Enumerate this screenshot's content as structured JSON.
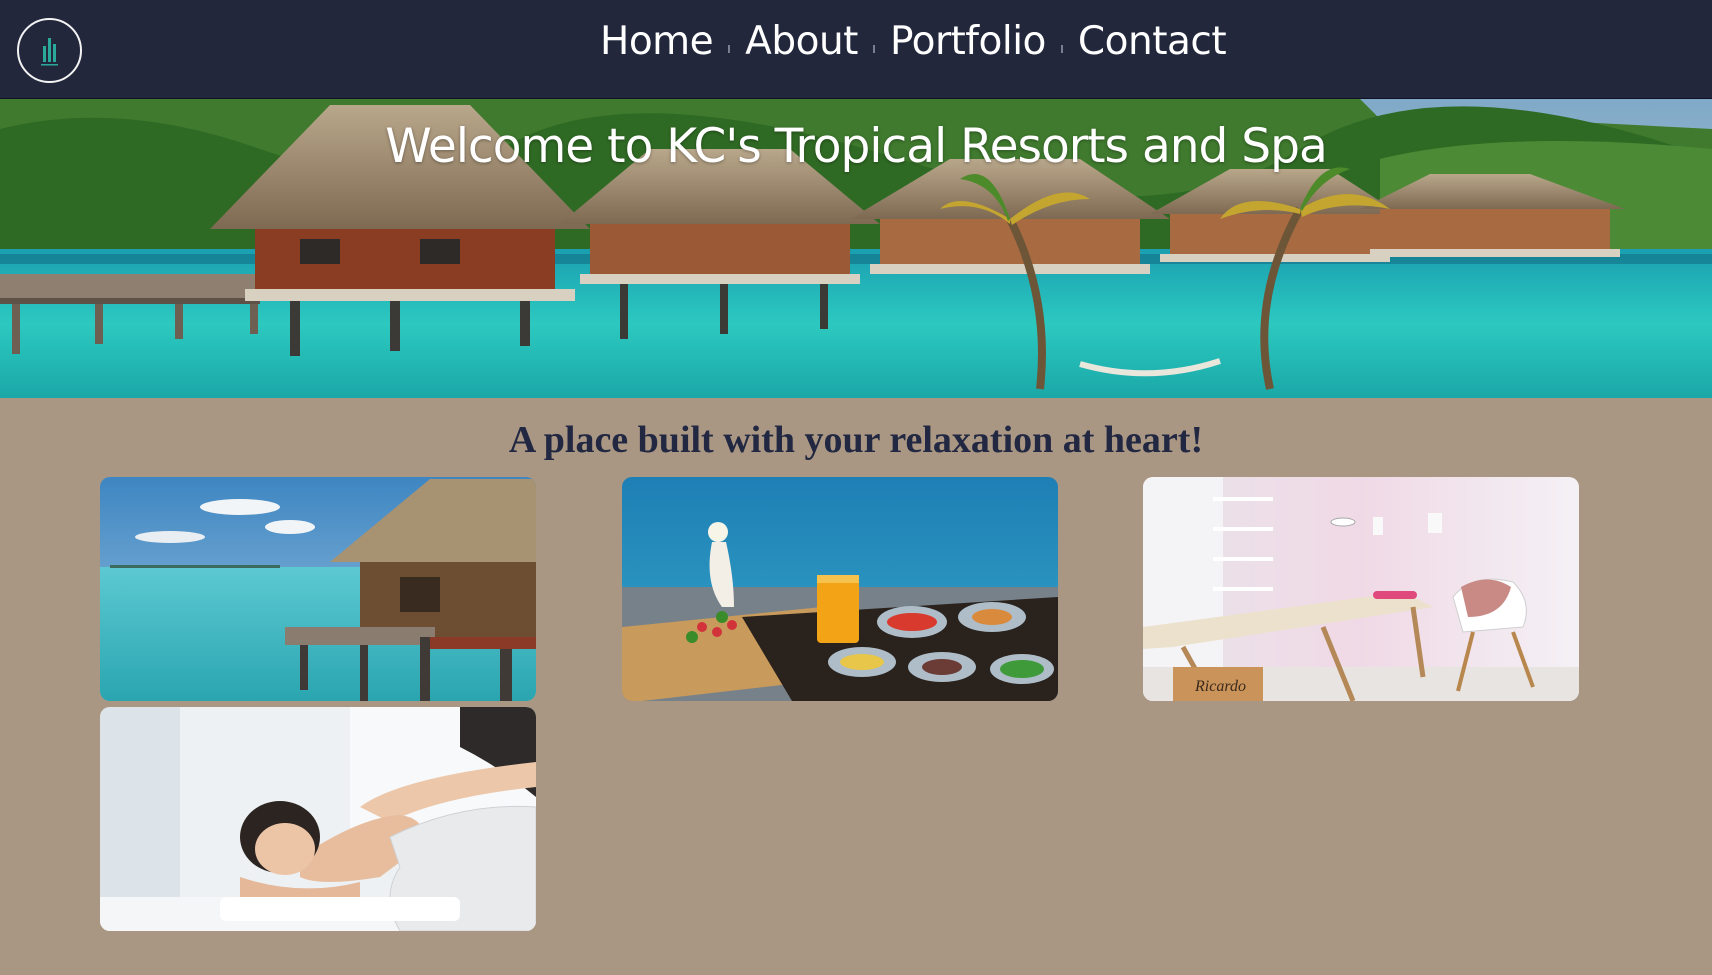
{
  "header": {
    "logo_icon": "resort-tower-logo-icon",
    "nav": [
      "Home",
      "About",
      "Portfolio",
      "Contact"
    ]
  },
  "hero": {
    "title": "Welcome to KC's Tropical Resorts and Spa",
    "image": "overwater-bungalows-photo"
  },
  "main": {
    "tagline": "A place built with your relaxation at heart!",
    "gallery": [
      {
        "image": "overwater-bungalow-photo"
      },
      {
        "image": "poolside-breakfast-tray-photo"
      },
      {
        "image": "massage-room-photo",
        "sign_text": "Ricardo"
      },
      {
        "image": "massage-treatment-photo"
      }
    ]
  },
  "colors": {
    "header_bg": "#22273c",
    "page_bg": "#a99784",
    "tagline": "#222842",
    "text_light": "#ffffff"
  }
}
